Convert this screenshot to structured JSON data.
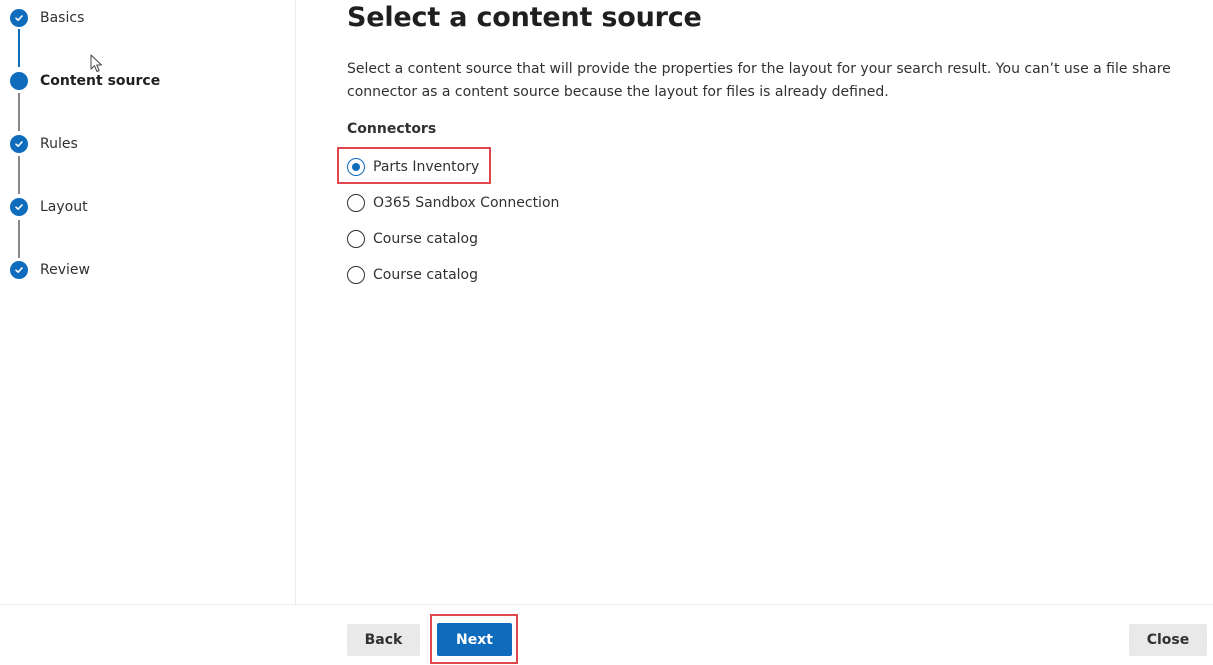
{
  "wizard": {
    "steps": [
      {
        "label": "Basics",
        "state": "completed"
      },
      {
        "label": "Content source",
        "state": "current"
      },
      {
        "label": "Rules",
        "state": "completed"
      },
      {
        "label": "Layout",
        "state": "completed"
      },
      {
        "label": "Review",
        "state": "completed"
      }
    ]
  },
  "main": {
    "title": "Select a content source",
    "description": "Select a content source that will provide the properties for the layout for your search result. You can’t use a file share connector as a content source because the layout for files is already defined.",
    "connectors_label": "Connectors",
    "connectors": [
      {
        "label": "Parts Inventory",
        "selected": true
      },
      {
        "label": "O365 Sandbox Connection",
        "selected": false
      },
      {
        "label": "Course catalog",
        "selected": false
      },
      {
        "label": "Course catalog",
        "selected": false
      }
    ]
  },
  "footer": {
    "back_label": "Back",
    "next_label": "Next",
    "close_label": "Close"
  },
  "colors": {
    "accent": "#0f6cbd",
    "highlight": "#e0474c"
  }
}
